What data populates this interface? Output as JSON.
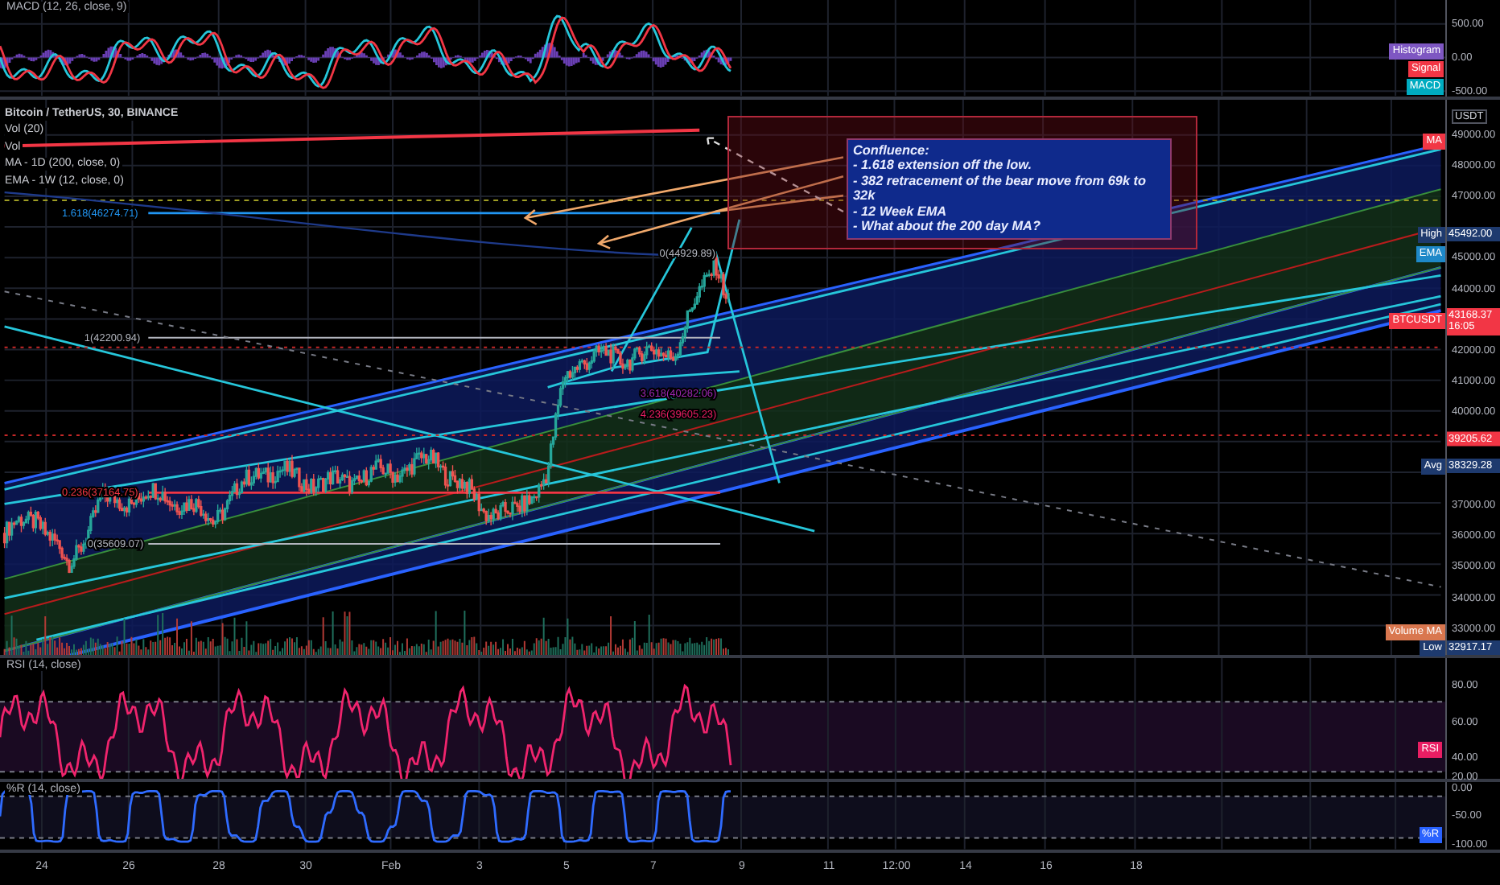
{
  "macd_pane": {
    "title": "MACD (12, 26, close, 9)",
    "axis_ticks": [
      "500.00",
      "0.00",
      "-500.00"
    ],
    "tags": [
      {
        "label": "Histogram",
        "color": "#7e57c2"
      },
      {
        "label": "Signal",
        "color": "#f23645"
      },
      {
        "label": "MACD",
        "color": "#00acc1"
      }
    ]
  },
  "main_pane": {
    "legend": [
      "Bitcoin / TetherUS, 30, BINANCE",
      "Vol (20)",
      "Vol",
      "MA - 1D (200, close, 0)",
      "EMA - 1W (12, close, 0)"
    ],
    "fib_labels": [
      {
        "text": "1.618(46274.71)",
        "color": "#2196f3"
      },
      {
        "text": "1(42200.94)",
        "color": "#b2b5be"
      },
      {
        "text": "0.236(37164.75)",
        "color": "#f23645"
      },
      {
        "text": "0(35609.07)",
        "color": "#b2b5be"
      },
      {
        "text": "0(44929.89)",
        "color": "#b2b5be"
      },
      {
        "text": "3.618(40282.06)",
        "color": "#9c27b0"
      },
      {
        "text": "4.236(39605.23)",
        "color": "#e91e63"
      }
    ],
    "note": {
      "title": "Confluence:",
      "lines": [
        "- 1.618 extension off the low.",
        "- 382 retracement of the bear move from 69k to 32k",
        "- 12 Week EMA",
        "- What about the 200 day MA?"
      ]
    },
    "axis_unit": "USDT",
    "axis_ticks": [
      "49000.00",
      "48000.00",
      "47000.00",
      "45000.00",
      "44000.00",
      "42000.00",
      "41000.00",
      "40000.00",
      "37000.00",
      "36000.00",
      "35000.00",
      "34000.00",
      "33000.00"
    ],
    "price_tags": [
      {
        "label": "MA",
        "color": "#f23645"
      },
      {
        "label": "High",
        "value": "45492.00",
        "color": "#1e3a6e"
      },
      {
        "label": "EMA",
        "color": "#1e88c8"
      },
      {
        "label": "BTCUSDT",
        "value": "43168.37",
        "sub": "16:05",
        "color": "#f23645"
      },
      {
        "value": "39205.62",
        "color": "#f23645"
      },
      {
        "label": "Avg",
        "value": "38329.28",
        "color": "#1e3a6e"
      },
      {
        "label": "Volume MA",
        "color": "#d9774f"
      },
      {
        "label": "Low",
        "value": "32917.17",
        "color": "#1e3a6e"
      }
    ]
  },
  "rsi_pane": {
    "title": "RSI (14, close)",
    "axis_ticks": [
      "80.00",
      "60.00",
      "40.00",
      "20.00"
    ],
    "tag": {
      "label": "RSI",
      "color": "#e91e63"
    }
  },
  "wr_pane": {
    "title": "%R (14, close)",
    "axis_ticks": [
      "0.00",
      "-50.00",
      "-100.00"
    ],
    "tag": {
      "label": "%R",
      "color": "#2962ff"
    }
  },
  "time_axis": [
    "24",
    "26",
    "28",
    "30",
    "Feb",
    "3",
    "5",
    "7",
    "9",
    "11",
    "12:00",
    "14",
    "16",
    "18"
  ]
}
